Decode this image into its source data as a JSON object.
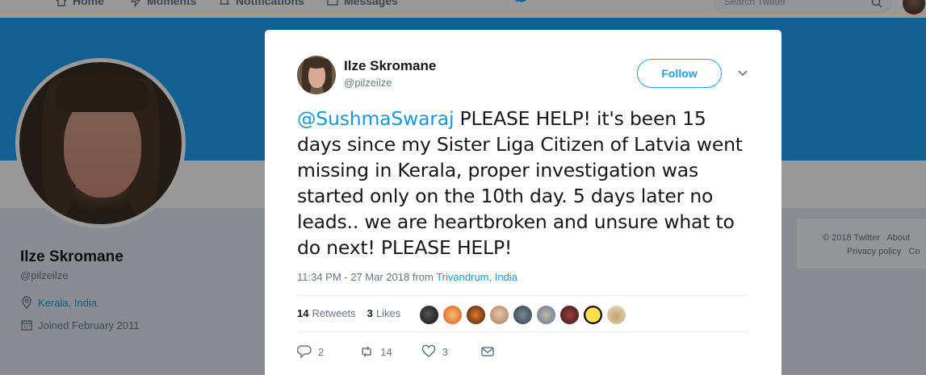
{
  "topnav": {
    "items": [
      {
        "label": "Home",
        "icon": "home-icon"
      },
      {
        "label": "Moments",
        "icon": "lightning-icon"
      },
      {
        "label": "Notifications",
        "icon": "bell-icon"
      },
      {
        "label": "Messages",
        "icon": "envelope-icon"
      }
    ],
    "search_placeholder": "Search Twitter"
  },
  "profile": {
    "name": "Ilze Skromane",
    "handle": "@pilzeilze",
    "location": "Kerala, India",
    "joined": "Joined February 2011"
  },
  "sidebar_footer": {
    "copyright": "© 2018 Twitter",
    "about": "About",
    "privacy": "Privacy policy",
    "cookies": "Co"
  },
  "tweet": {
    "author_name": "Ilze Skromane",
    "author_handle": "@pilzeilze",
    "follow_label": "Follow",
    "mention": "@SushmaSwaraj",
    "text": " PLEASE HELP! it's been 15 days since my Sister Liga Citizen of Latvia went missing in Kerala, proper investigation was started only on the 10th day. 5 days later no leads.. we are heartbroken and unsure what to do next! PLEASE HELP!",
    "timestamp": "11:34 PM - 27 Mar 2018",
    "from_label": "from",
    "source": "Trivandrum, India",
    "retweet_count": "14",
    "retweet_label": "Retweets",
    "like_count": "3",
    "like_label": "Likes",
    "actions": {
      "reply_count": "2",
      "retweet_count": "14",
      "like_count": "3"
    }
  },
  "colors": {
    "accent": "#1da1f2",
    "link": "#1b95e0",
    "text": "#14171a",
    "muted": "#657786"
  }
}
